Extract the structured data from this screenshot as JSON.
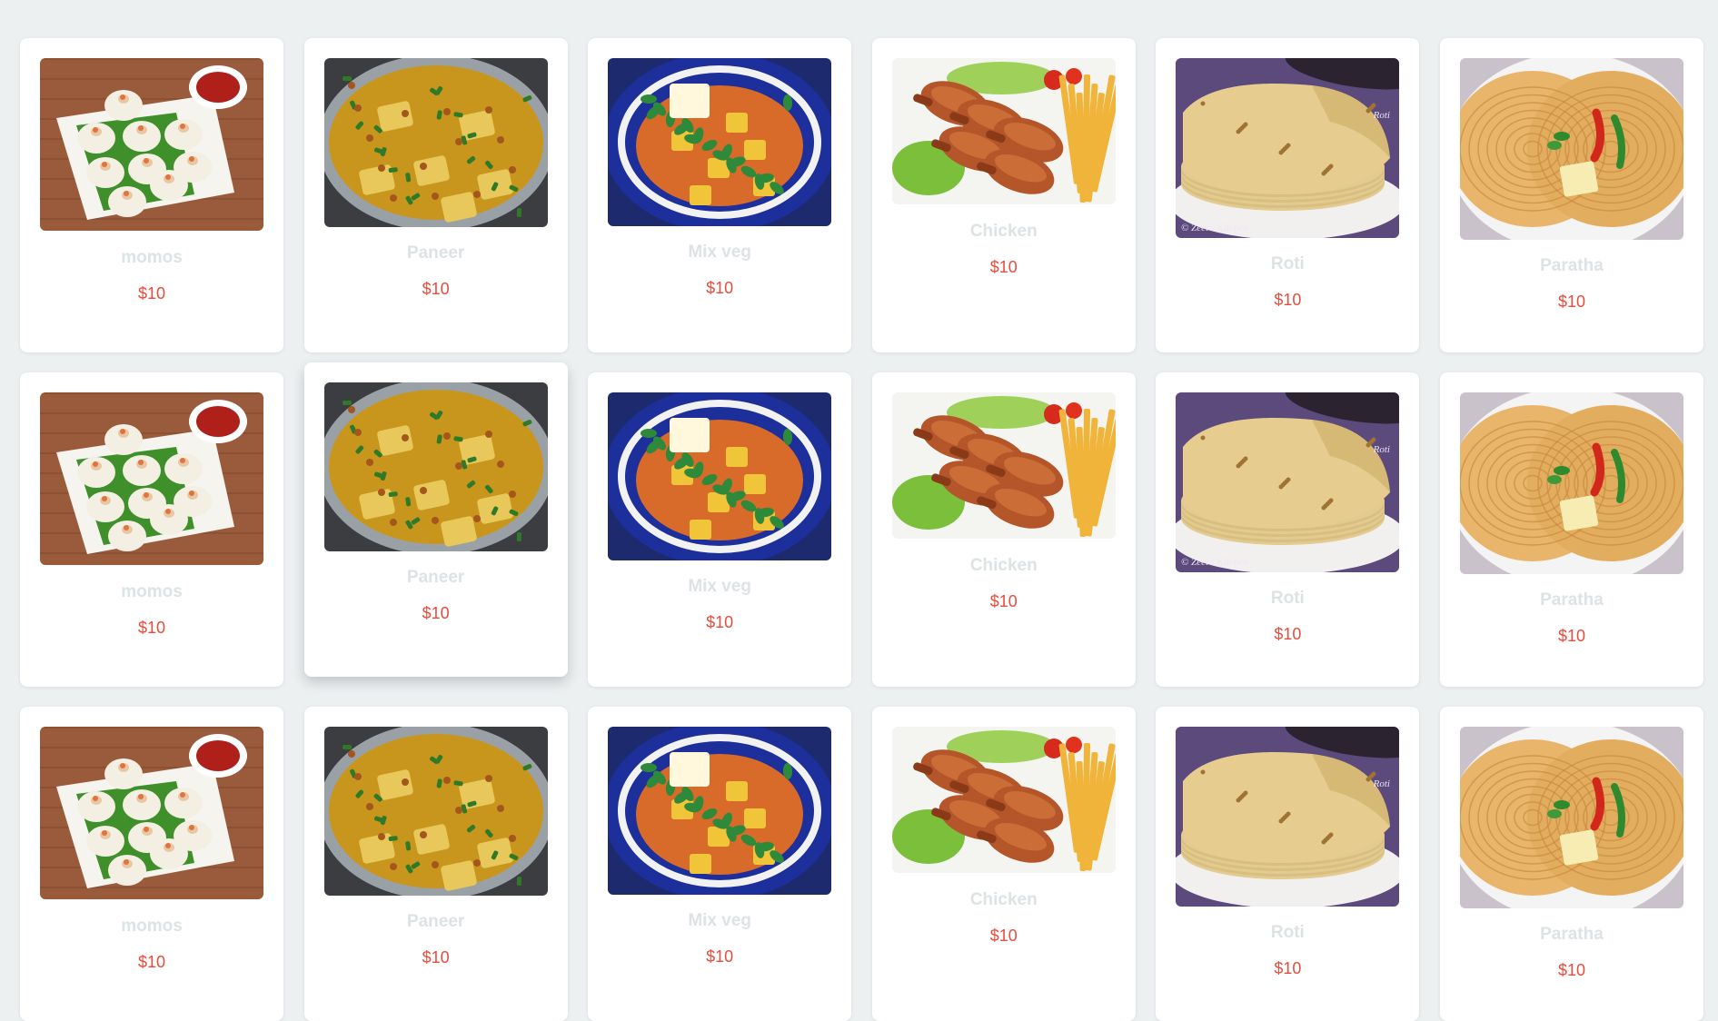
{
  "colors": {
    "page_background": "#ecf0f1",
    "card_background": "#ffffff",
    "item_name": "#dde3e5",
    "price": "#e74c3c"
  },
  "menu": {
    "rows": [
      [
        {
          "name": "momos",
          "price": "$10",
          "image": "momos-photo"
        },
        {
          "name": "Paneer",
          "price": "$10",
          "image": "paneer-photo"
        },
        {
          "name": "Mix veg",
          "price": "$10",
          "image": "mix-veg-photo"
        },
        {
          "name": "Chicken",
          "price": "$10",
          "image": "chicken-photo"
        },
        {
          "name": "Roti",
          "price": "$10",
          "image": "roti-photo",
          "watermark": "© Zeel's Kitchen",
          "corner_label": "Roti"
        },
        {
          "name": "Paratha",
          "price": "$10",
          "image": "paratha-photo"
        }
      ],
      [
        {
          "name": "momos",
          "price": "$10",
          "image": "momos-photo"
        },
        {
          "name": "Paneer",
          "price": "$10",
          "image": "paneer-photo"
        },
        {
          "name": "Mix veg",
          "price": "$10",
          "image": "mix-veg-photo"
        },
        {
          "name": "Chicken",
          "price": "$10",
          "image": "chicken-photo"
        },
        {
          "name": "Roti",
          "price": "$10",
          "image": "roti-photo",
          "watermark": "© Zeel's Kitchen",
          "corner_label": "Roti"
        },
        {
          "name": "Paratha",
          "price": "$10",
          "image": "paratha-photo"
        }
      ],
      [
        {
          "name": "momos",
          "price": "$10",
          "image": "momos-photo"
        },
        {
          "name": "Paneer",
          "price": "$10",
          "image": "paneer-photo"
        },
        {
          "name": "Mix veg",
          "price": "$10",
          "image": "mix-veg-photo"
        },
        {
          "name": "Chicken",
          "price": "$10",
          "image": "chicken-photo"
        },
        {
          "name": "Roti",
          "price": "$10",
          "image": "roti-photo",
          "corner_label": "Roti"
        },
        {
          "name": "Paratha",
          "price": "$10",
          "image": "paratha-photo"
        }
      ]
    ]
  }
}
